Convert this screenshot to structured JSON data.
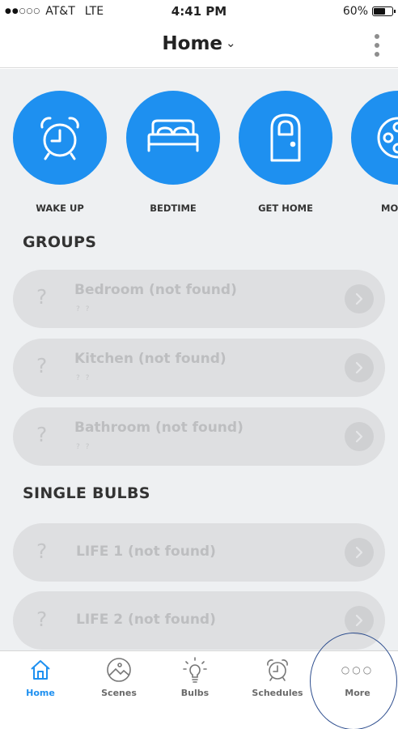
{
  "status_bar": {
    "carrier": "AT&T",
    "network": "LTE",
    "time": "4:41 PM",
    "battery": "60%",
    "battery_level": 0.6,
    "signal_dots": "●●○○○"
  },
  "header": {
    "title": "Home",
    "chevron": "⌄"
  },
  "scenes": [
    {
      "label": "WAKE UP",
      "icon": "alarm-clock-icon"
    },
    {
      "label": "BEDTIME",
      "icon": "bed-icon"
    },
    {
      "label": "GET HOME",
      "icon": "door-icon"
    },
    {
      "label": "MOVIE",
      "icon": "film-reel-icon"
    }
  ],
  "groups": {
    "heading": "GROUPS",
    "items": [
      {
        "mark": "?",
        "name": "Bedroom (not found)",
        "sub": "? ?"
      },
      {
        "mark": "?",
        "name": "Kitchen (not found)",
        "sub": "? ?"
      },
      {
        "mark": "?",
        "name": "Bathroom (not found)",
        "sub": "? ?"
      }
    ]
  },
  "single_bulbs": {
    "heading": "SINGLE BULBS",
    "items": [
      {
        "mark": "?",
        "name": "LIFE 1 (not found)"
      },
      {
        "mark": "?",
        "name": "LIFE 2 (not found)"
      }
    ]
  },
  "tabbar": {
    "tabs": [
      {
        "label": "Home",
        "icon": "house-icon",
        "active": true
      },
      {
        "label": "Scenes",
        "icon": "landscape-icon",
        "active": false
      },
      {
        "label": "Bulbs",
        "icon": "bulb-icon",
        "active": false
      },
      {
        "label": "Schedules",
        "icon": "alarm-clock-icon",
        "active": false
      },
      {
        "label": "More",
        "icon": "more-icon",
        "active": false,
        "glyph": "○○○"
      }
    ]
  },
  "colors": {
    "accent": "#1e90f0",
    "background": "#eef0f2",
    "row_disabled": "#dedfe1"
  }
}
